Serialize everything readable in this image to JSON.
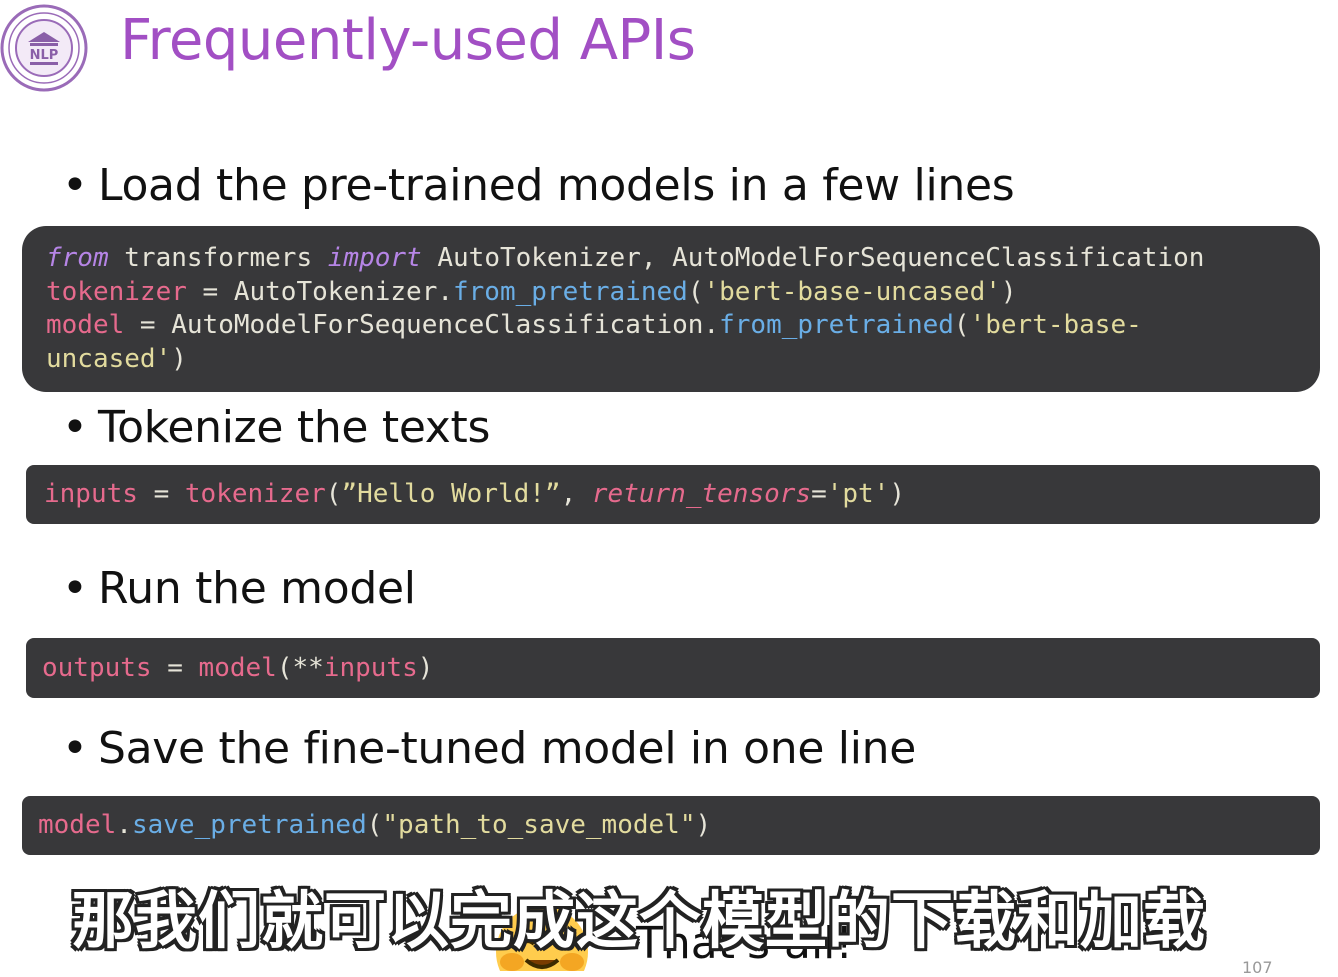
{
  "slide": {
    "title": "Frequently-used APIs",
    "bullets": [
      "Load the pre-trained models in a few lines",
      "Tokenize the texts",
      "Run the model",
      "Save the fine-tuned model in one line"
    ],
    "code1": {
      "l1_kw1": "from",
      "l1_t1": " transformers ",
      "l1_kw2": "import",
      "l1_t2": " AutoTokenizer, AutoModelForSequenceClassification",
      "l2_var": "tokenizer",
      "l2_t1": " = AutoTokenizer.",
      "l2_fn": "from_pretrained",
      "l2_t2": "(",
      "l2_str": "'bert-base-uncased'",
      "l2_t3": ")",
      "l3_var": "model",
      "l3_t1": " = AutoModelForSequenceClassification.",
      "l3_fn": "from_pretrained",
      "l3_t2": "(",
      "l3_str": "'bert-base-",
      "l4_str": "uncased'",
      "l4_t1": ")"
    },
    "code2": {
      "var": "inputs",
      "t1": " = ",
      "fn": "tokenizer",
      "t2": "(",
      "str": "”Hello World!”",
      "t3": ", ",
      "kwarg": "return_tensors",
      "t4": "=",
      "str2": "'pt'",
      "t5": ")"
    },
    "code3": {
      "var": "outputs",
      "t1": " = ",
      "fn": "model",
      "t2": "(**",
      "arg": "inputs",
      "t3": ")"
    },
    "code4": {
      "var": "model",
      "t1": ".",
      "fn": "save_pretrained",
      "t2": "(",
      "str": "\"path_to_save_model\"",
      "t3": ")"
    },
    "closing": "That's all!",
    "page_number": "107"
  },
  "logo": {
    "text": "NLP",
    "color": "#8a5fa8"
  },
  "emoji_icon": "hugging-face-emoji",
  "subtitle": "那我们就可以完成这个模型的下载和加载",
  "colors": {
    "title": "#a24fc4",
    "code_bg": "#38383a",
    "keyword": "#b685e6",
    "variable": "#e66a8d",
    "function": "#6aaee6",
    "string": "#e2db9e"
  }
}
